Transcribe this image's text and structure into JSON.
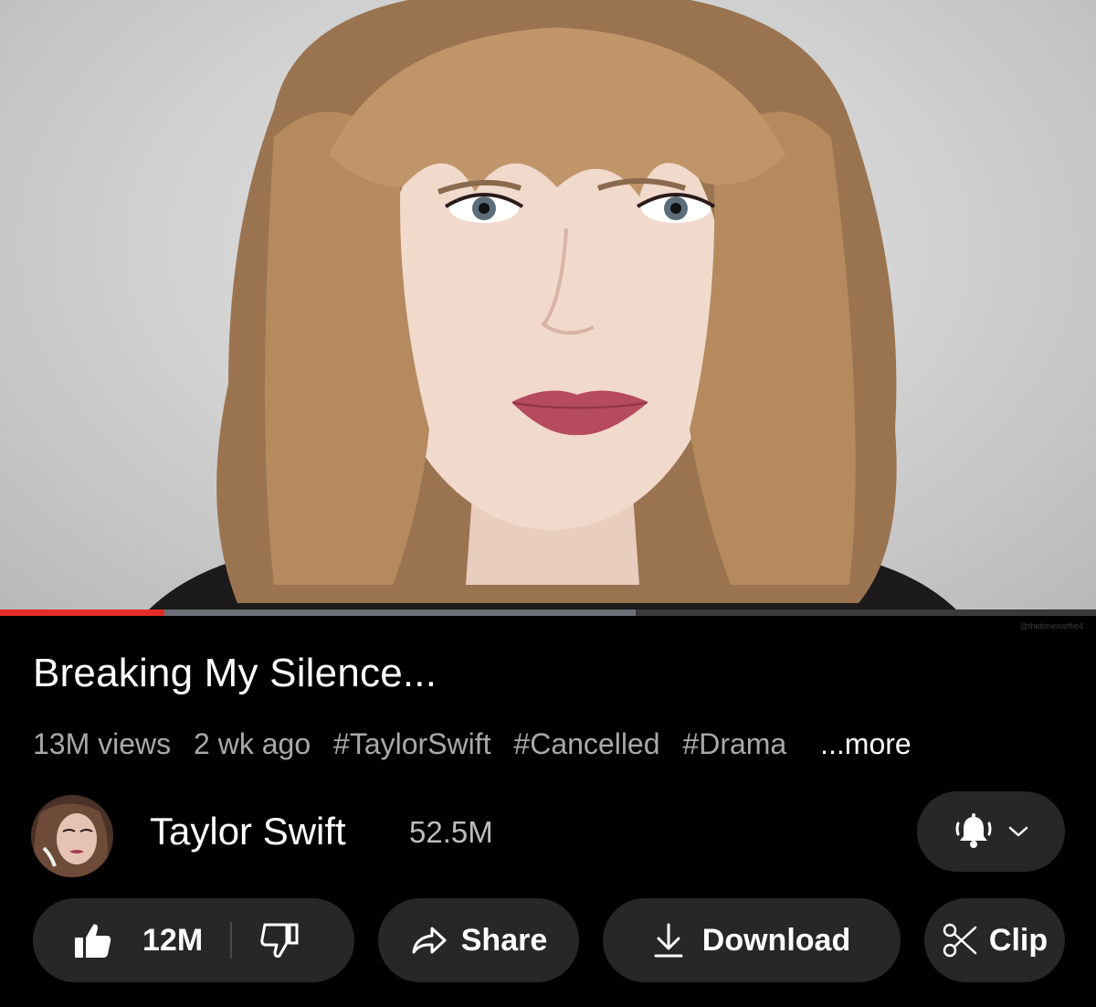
{
  "video": {
    "thumbnail_icon": "video-frame-portrait",
    "progress_played": 0.15,
    "progress_buffered": 0.58,
    "watermark": "@thetoneswiftie4"
  },
  "title": "Breaking My Silence...",
  "meta": {
    "views": "13M views",
    "age": "2 wk ago",
    "tags": [
      "#TaylorSwift",
      "#Cancelled",
      "#Drama"
    ],
    "more": "...more"
  },
  "channel": {
    "name": "Taylor Swift",
    "subscribers": "52.5M",
    "bell_icon": "bell-ringing-icon",
    "chevron_icon": "chevron-down-icon"
  },
  "actions": {
    "like_count": "12M",
    "share_label": "Share",
    "download_label": "Download",
    "clip_label": "Clip"
  },
  "colors": {
    "background": "#000000",
    "button_bg": "#272727",
    "progress_played": "#e52d27",
    "meta_text": "#a9a9a9"
  }
}
